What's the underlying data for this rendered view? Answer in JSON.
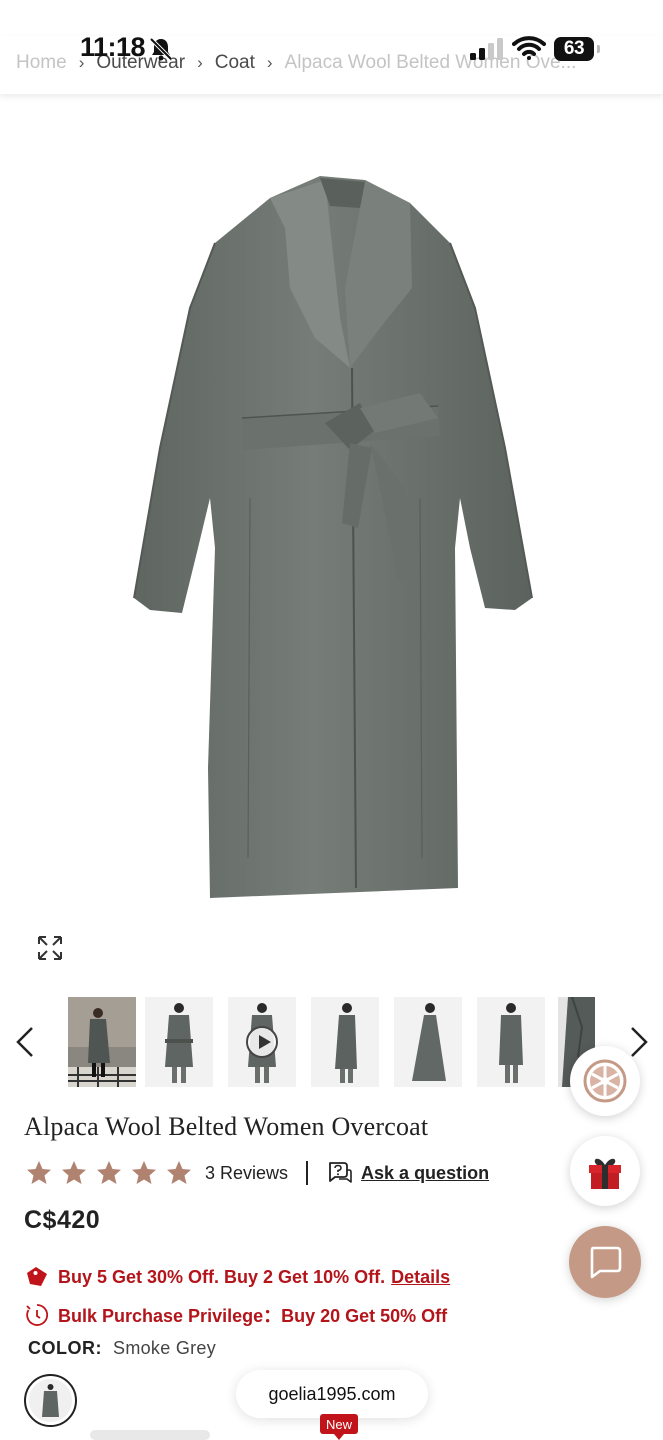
{
  "status_bar": {
    "time": "11:18",
    "battery": "63"
  },
  "breadcrumb": [
    {
      "label": "Home"
    },
    {
      "label": "Outerwear"
    },
    {
      "label": "Coat"
    },
    {
      "label": "Alpaca Wool Belted Women Ove..."
    }
  ],
  "gallery": {
    "thumbnail_count": 7,
    "video_thumbnail_index": 2
  },
  "product": {
    "title": "Alpaca Wool Belted Women Overcoat",
    "rating_stars": 5,
    "reviews_label": "3 Reviews",
    "ask_label": "Ask a question",
    "price": "C$420",
    "promo_1_text": "Buy 5 Get 30% Off. Buy 2 Get 10% Off.",
    "promo_1_link": "Details",
    "promo_2_text": "Bulk Purchase Privilege：Buy 20 Get 50% Off",
    "color_label": "COLOR:",
    "color_value": "Smoke Grey"
  },
  "footer": {
    "url": "goelia1995.com",
    "new_badge": "New"
  },
  "colors": {
    "accent_red": "#b3151b",
    "star_color": "#b08270",
    "chat_button": "#c49a86",
    "coat_grey": "#6e7470"
  }
}
